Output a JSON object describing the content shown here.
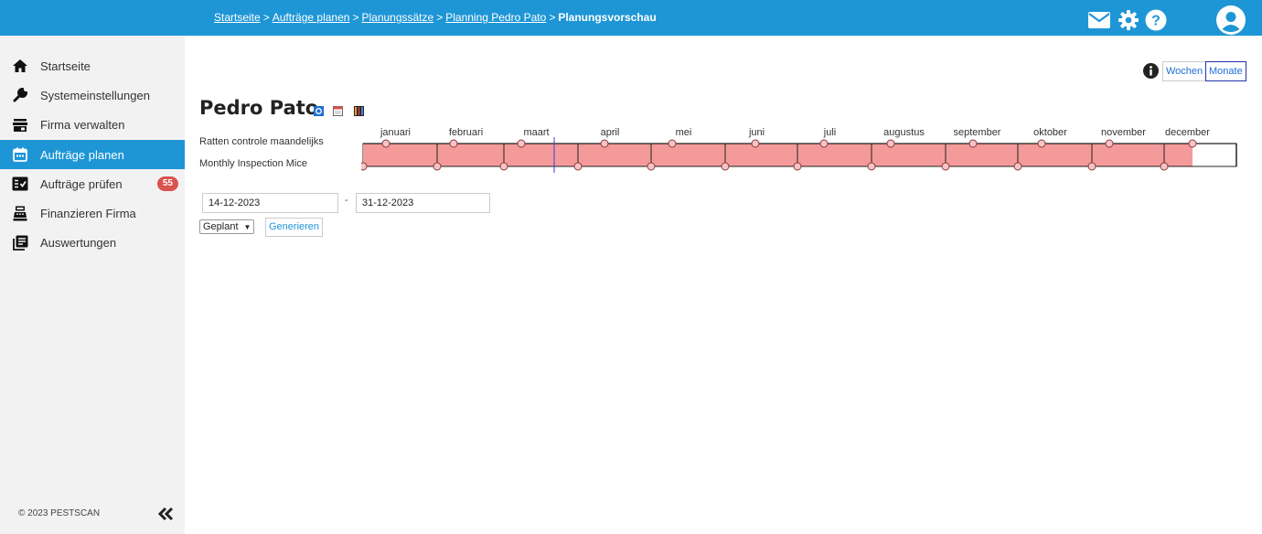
{
  "breadcrumb": {
    "items": [
      "Startseite",
      "Aufträge planen",
      "Planungssätze",
      "Planning Pedro Pato"
    ],
    "separator": ">",
    "current": "Planungsvorschau"
  },
  "header_icons": [
    "mail-icon",
    "gear-icon",
    "help-icon",
    "german-flag-icon",
    "user-icon"
  ],
  "sidebar": {
    "items": [
      {
        "label": "Startseite",
        "icon": "home-icon"
      },
      {
        "label": "Systemeinstellungen",
        "icon": "wrench-icon"
      },
      {
        "label": "Firma verwalten",
        "icon": "store-icon"
      },
      {
        "label": "Aufträge planen",
        "icon": "calendar-icon",
        "active": true
      },
      {
        "label": "Aufträge prüfen",
        "icon": "checklist-icon",
        "badge": "55"
      },
      {
        "label": "Finanzieren Firma",
        "icon": "cash-register-icon"
      },
      {
        "label": "Auswertungen",
        "icon": "reports-icon"
      }
    ],
    "footer": "© 2023 PESTSCAN"
  },
  "view_toggle": {
    "weeks": "Wochen",
    "months": "Monate",
    "selected": "Monate"
  },
  "page": {
    "title": "Pedro Pato"
  },
  "planning": {
    "rows": [
      "Ratten controle maandelijks",
      "Monthly Inspection Mice"
    ],
    "months": [
      "januari",
      "februari",
      "maart",
      "april",
      "mei",
      "juni",
      "juli",
      "augustus",
      "september",
      "oktober",
      "november",
      "december"
    ],
    "bar_color": "#f59a9a",
    "marker_fill": "#f7c3c8",
    "today_line_color": "#3344cc"
  },
  "form": {
    "date_from": "14-12-2023",
    "date_to": "31-12-2023",
    "dash": "-",
    "status": "Geplant",
    "generate": "Generieren"
  },
  "colors": {
    "primary": "#1e96d6",
    "badge": "#d9534f"
  }
}
